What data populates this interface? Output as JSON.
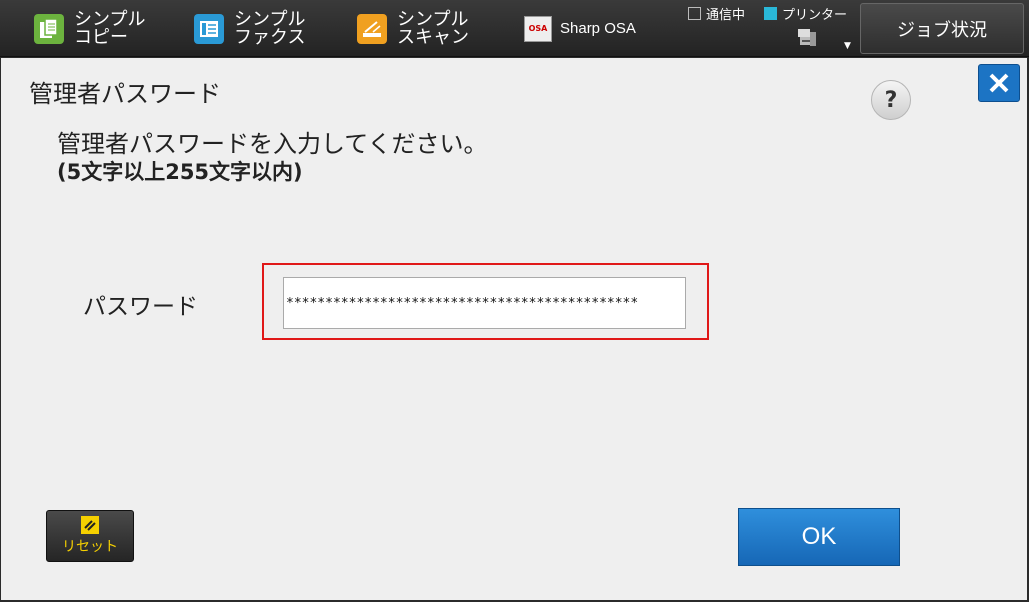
{
  "topbar": {
    "nav": [
      {
        "label": "シンプル\nコピー",
        "icon": "copy-icon",
        "color": "#6cb33e"
      },
      {
        "label": "シンプル\nファクス",
        "icon": "fax-icon",
        "color": "#2a9ad6"
      },
      {
        "label": "シンプル\nスキャン",
        "icon": "scan-icon",
        "color": "#f0a020"
      }
    ],
    "osa_label": "Sharp OSA",
    "osa_icon_text": "OSA",
    "status": {
      "comm_label": "通信中",
      "printer_label": "プリンター"
    },
    "job_status_label": "ジョブ状況"
  },
  "dialog": {
    "title": "管理者パスワード",
    "help_label": "?",
    "instruction": "管理者パスワードを入力してください。",
    "sub_instruction": "(5文字以上255文字以内)",
    "password_label": "パスワード",
    "password_value": "*********************************************",
    "reset_label": "リセット",
    "ok_label": "OK"
  },
  "colors": {
    "accent_blue": "#1c74c4",
    "highlight_red": "#e01818",
    "reset_yellow": "#f5d000"
  }
}
